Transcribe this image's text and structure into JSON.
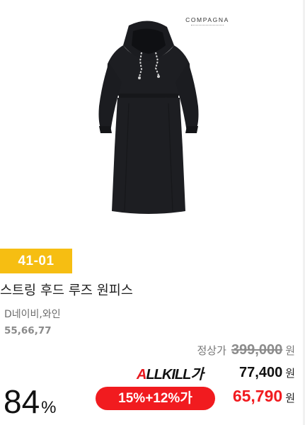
{
  "brand": {
    "logo_text": "COMPAGNA"
  },
  "product": {
    "image_icon": "dress-image",
    "code_badge": "41-01",
    "name": "스트링 후드 루즈 원피스",
    "colors": "D네이비,와인",
    "sizes": "55,66,77"
  },
  "pricing": {
    "list_price_label": "정상가",
    "list_price": "399,000",
    "currency": "원",
    "allkill_logo_a": "A",
    "allkill_logo_rest": "LLKILL가",
    "allkill_price": "77,400",
    "discount_number": "84",
    "discount_sign": "%",
    "coupon_label": "15%+12%가",
    "final_price": "65,790"
  },
  "colors": {
    "badge_yellow": "#f6be12",
    "sale_red": "#f11b1f",
    "allkill_red": "#e8191f"
  }
}
